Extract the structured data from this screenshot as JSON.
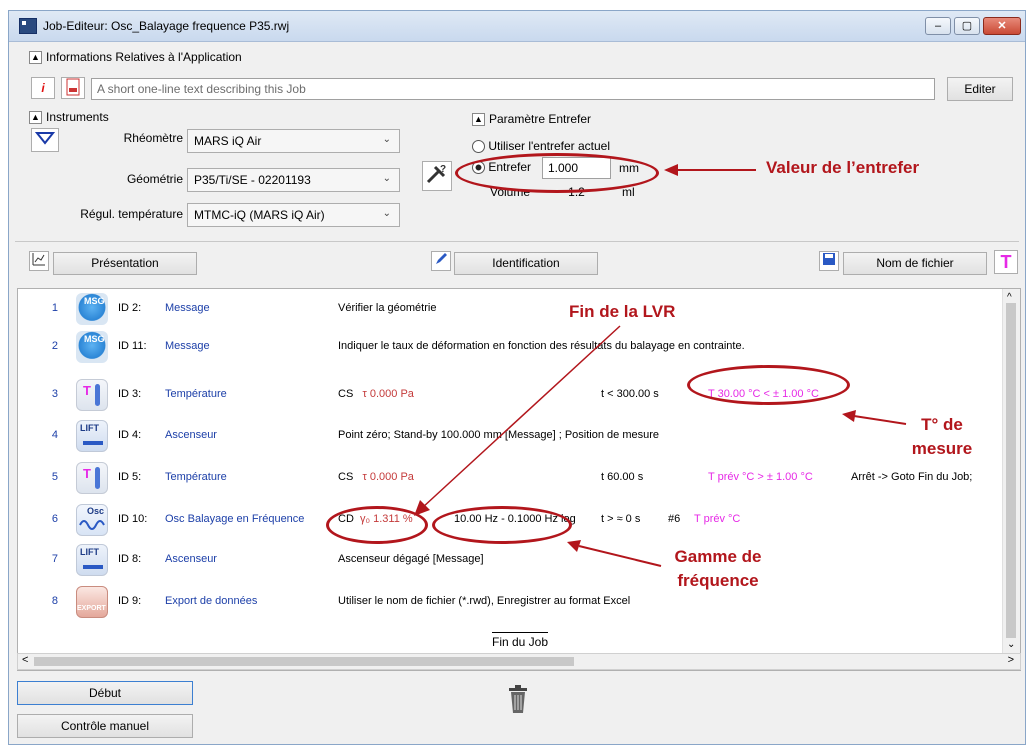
{
  "window": {
    "title": "Job-Editeur: Osc_Balayage frequence P35.rwj",
    "min_label": "–",
    "max_label": "▢",
    "close_label": "✕"
  },
  "app_info": {
    "header": "Informations Relatives à l'Application",
    "info_icon": "i",
    "description_placeholder": "A short one-line text describing this Job",
    "edit_label": "Editer"
  },
  "instruments": {
    "header": "Instruments",
    "rheometer_label": "Rhéomètre",
    "rheometer_value": "MARS iQ Air",
    "geometry_label": "Géométrie",
    "geometry_value": "P35/Ti/SE - 02201193",
    "temp_label": "Régul. température",
    "temp_value": "MTMC-iQ (MARS iQ Air)"
  },
  "gap": {
    "header": "Paramètre Entrefer",
    "option_current": "Utiliser l'entrefer actuel",
    "option_gap": "Entrefer",
    "gap_value": "1.000",
    "gap_unit": "mm",
    "volume_label": "Volume",
    "volume_value": "1.2",
    "volume_unit": "ml"
  },
  "toolbar": {
    "presentation": "Présentation",
    "identification": "Identification",
    "filename": "Nom de fichier"
  },
  "rows": [
    {
      "num": "1",
      "id": "ID 2:",
      "name": "Message",
      "c1": "Vérifier la géométrie",
      "c2": "",
      "c3": "",
      "c4": "",
      "icon": "MSG"
    },
    {
      "num": "2",
      "id": "ID 11:",
      "name": "Message",
      "c1": "Indiquer le taux de déformation en fonction des résultats du balayage en contrainte.",
      "c2": "",
      "c3": "",
      "c4": "",
      "icon": "MSG"
    },
    {
      "num": "3",
      "id": "ID 3:",
      "name": "Température",
      "c1a": "CS",
      "c1b": "τ 0.000 Pa",
      "c2": "t < 300.00 s",
      "c3": "T 30.00 °C < ± 1.00 °C",
      "c4": "",
      "icon": "T"
    },
    {
      "num": "4",
      "id": "ID 4:",
      "name": "Ascenseur",
      "c1": "Point zéro; Stand-by 100.000 mm [Message] ; Position de mesure",
      "c2": "",
      "c3": "",
      "c4": "",
      "icon": "LIFT"
    },
    {
      "num": "5",
      "id": "ID 5:",
      "name": "Température",
      "c1a": "CS",
      "c1b": "τ 0.000 Pa",
      "c2": "t 60.00 s",
      "c3": "T prév °C > ± 1.00 °C",
      "c4": "Arrêt -> Goto Fin du Job;",
      "icon": "T"
    },
    {
      "num": "6",
      "id": "ID 10:",
      "name": "Osc Balayage en Fréquence",
      "c1a": "CD",
      "c1b": "γ₀ 1.311 %",
      "c1c": "10.00 Hz - 0.1000 Hz log",
      "c2": "t > ≈ 0 s",
      "c2b": "#6",
      "c3": "T prév °C",
      "c4": "",
      "icon": "Osc"
    },
    {
      "num": "7",
      "id": "ID 8:",
      "name": "Ascenseur",
      "c1": "Ascenseur dégagé [Message]",
      "c2": "",
      "c3": "",
      "c4": "",
      "icon": "LIFT"
    },
    {
      "num": "8",
      "id": "ID 9:",
      "name": "Export de données",
      "c1": "Utiliser le nom de fichier (*.rwd), Enregistrer au format Excel",
      "c2": "",
      "c3": "",
      "c4": "",
      "icon": "EXPORT"
    }
  ],
  "end_label": "Fin du Job",
  "bottom": {
    "start": "Début",
    "manual": "Contrôle manuel"
  },
  "annotations": {
    "gap": "Valeur de l’entrefer",
    "lvr": "Fin de la LVR",
    "temp": "T° de mesure",
    "range": "Gamme de fréquence"
  },
  "colors": {
    "annotation": "#b2161c",
    "link_blue": "#1c3fa8",
    "magenta": "#e629e6"
  }
}
